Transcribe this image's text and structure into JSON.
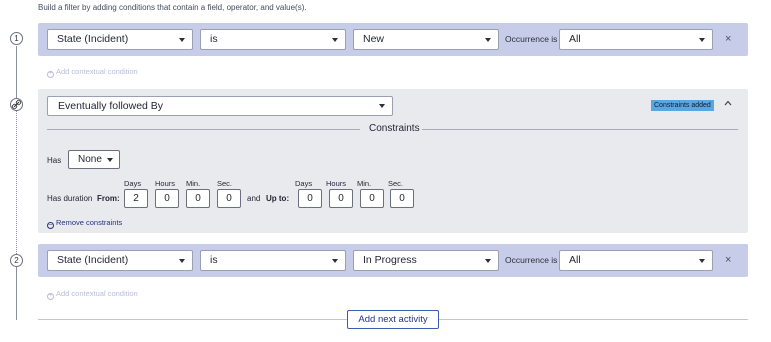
{
  "intro": "Build a filter by adding conditions that contain a field, operator, and value(s).",
  "steps": [
    "1",
    "2"
  ],
  "condition1": {
    "field": "State (Incident)",
    "operator": "is",
    "value": "New",
    "occurrence_label": "Occurrence is",
    "occurrence": "All",
    "close": "×",
    "contextual": "Add contextual condition"
  },
  "relation": {
    "type": "Eventually followed By",
    "badge": "Constraints added",
    "constraints_title": "Constraints",
    "has_label": "Has",
    "has_value": "None",
    "duration_label": "Has duration",
    "from_label": "From:",
    "and_label": "and",
    "upto_label": "Up to:",
    "units": [
      "Days",
      "Hours",
      "Min.",
      "Sec."
    ],
    "from_values": [
      "2",
      "0",
      "0",
      "0"
    ],
    "upto_values": [
      "0",
      "0",
      "0",
      "0"
    ],
    "remove": "Remove constraints"
  },
  "condition2": {
    "field": "State (Incident)",
    "operator": "is",
    "value": "In Progress",
    "occurrence_label": "Occurrence is",
    "occurrence": "All",
    "close": "×",
    "contextual": "Add contextual condition"
  },
  "add_next": "Add next activity",
  "colors": {
    "condition_bg": "#c7cde8",
    "relation_bg": "#e9eaee",
    "badge": "#5aa6e0",
    "link": "#22357a"
  }
}
